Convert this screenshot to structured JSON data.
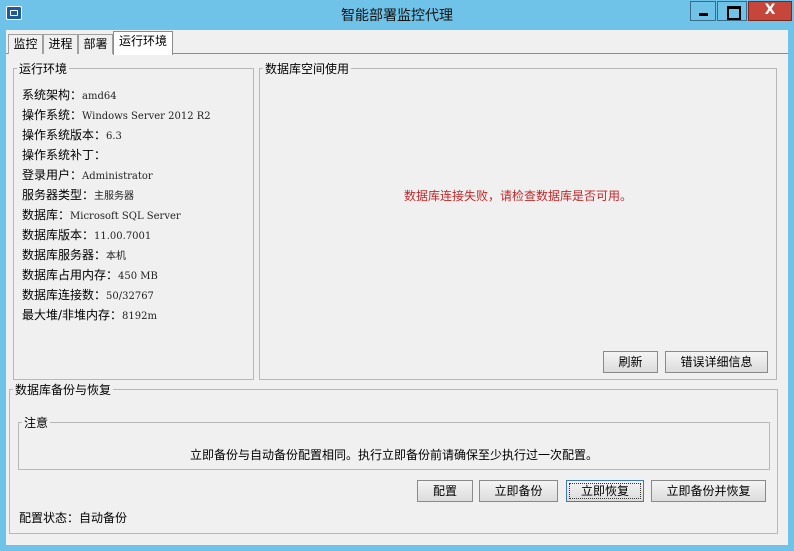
{
  "window": {
    "title": "智能部署监控代理",
    "close_glyph": "X"
  },
  "tabs": [
    {
      "label": "监控",
      "active": false
    },
    {
      "label": "进程",
      "active": false
    },
    {
      "label": "部署",
      "active": false
    },
    {
      "label": "运行环境",
      "active": true
    }
  ],
  "env": {
    "legend": "运行环境",
    "items": [
      {
        "label": "系统架构：",
        "value": "amd64"
      },
      {
        "label": "操作系统：",
        "value": "Windows Server 2012 R2"
      },
      {
        "label": "操作系统版本：",
        "value": "6.3"
      },
      {
        "label": "操作系统补丁：",
        "value": ""
      },
      {
        "label": "登录用户：",
        "value": "Administrator"
      },
      {
        "label": "服务器类型：",
        "value": "主服务器"
      },
      {
        "label": "数据库：",
        "value": "Microsoft SQL Server"
      },
      {
        "label": "数据库版本：",
        "value": "11.00.7001"
      },
      {
        "label": "数据库服务器：",
        "value": "本机"
      },
      {
        "label": "数据库占用内存：",
        "value": "450 MB"
      },
      {
        "label": "数据库连接数：",
        "value": "50/32767"
      },
      {
        "label": "最大堆/非堆内存：",
        "value": "8192m"
      }
    ]
  },
  "db_space": {
    "legend": "数据库空间使用",
    "error": "数据库连接失败，请检查数据库是否可用。",
    "refresh_label": "刷新",
    "error_detail_label": "错误详细信息"
  },
  "backup": {
    "legend": "数据库备份与恢复",
    "notice_legend": "注意",
    "notice_text": "立即备份与自动备份配置相同。执行立即备份前请确保至少执行过一次配置。",
    "config_label": "配置",
    "backup_now_label": "立即备份",
    "restore_now_label": "立即恢复",
    "backup_and_restore_label": "立即备份并恢复",
    "status_label": "配置状态：",
    "status_value": "自动备份"
  }
}
